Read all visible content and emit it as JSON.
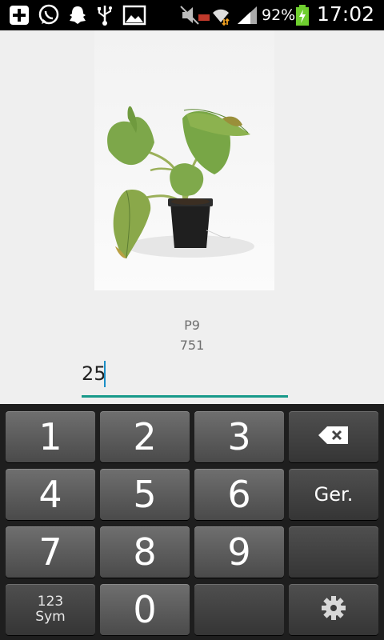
{
  "status_bar": {
    "battery_percent": "92%",
    "time": "17:02",
    "icons": [
      "plus-square-icon",
      "whatsapp-icon",
      "snapchat-ghost-icon",
      "usb-icon",
      "gallery-icon",
      "mute-icon",
      "data-transfer-icon",
      "wifi-icon",
      "signal-icon",
      "battery-charging-icon"
    ]
  },
  "content": {
    "image_subject": "potted plant photo",
    "name": "P9",
    "code": "751",
    "input_value": "25",
    "accent_color": "#179a8a"
  },
  "keyboard": {
    "keys": {
      "k1": "1",
      "k2": "2",
      "k3": "3",
      "k4": "4",
      "k5": "5",
      "k6": "6",
      "k7": "7",
      "k8": "8",
      "k9": "9",
      "k0": "0",
      "go": "Ger.",
      "sym_line1": "123",
      "sym_line2": "Sym"
    }
  }
}
